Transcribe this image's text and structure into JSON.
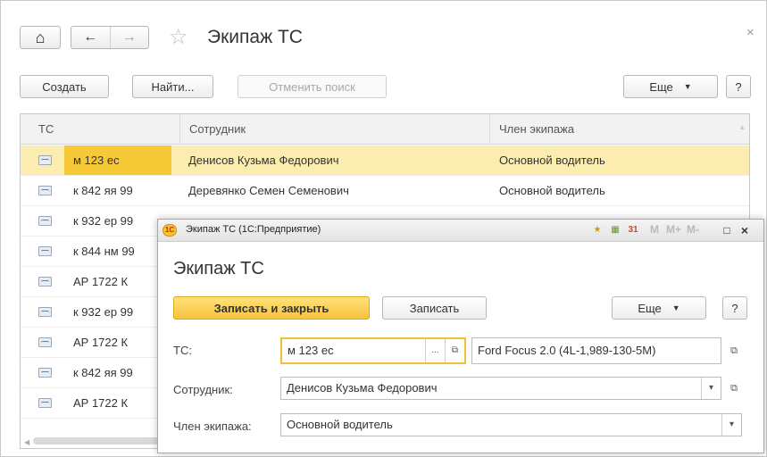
{
  "window": {
    "title": "Экипаж ТС",
    "close_glyph": "×",
    "home_glyph": "⌂",
    "back_glyph": "←",
    "forward_glyph": "→",
    "star_glyph": "☆"
  },
  "toolbar": {
    "create": "Создать",
    "find": "Найти...",
    "cancel_search": "Отменить поиск",
    "more": "Еще",
    "help": "?"
  },
  "table": {
    "columns": [
      "ТС",
      "Сотрудник",
      "Член экипажа"
    ],
    "rows": [
      {
        "ts": "м 123 ес",
        "employee": "Денисов Кузьма Федорович",
        "role": "Основной водитель"
      },
      {
        "ts": "к 842 яя 99",
        "employee": "Деревянко Семен Семенович",
        "role": "Основной водитель"
      },
      {
        "ts": "к 932 ер 99",
        "employee": "",
        "role": ""
      },
      {
        "ts": "к 844 нм 99",
        "employee": "",
        "role": ""
      },
      {
        "ts": "АР 1722 К",
        "employee": "",
        "role": ""
      },
      {
        "ts": "к 932 ер 99",
        "employee": "",
        "role": ""
      },
      {
        "ts": "АР 1722 К",
        "employee": "",
        "role": ""
      },
      {
        "ts": "к 842 яя 99",
        "employee": "",
        "role": ""
      },
      {
        "ts": "АР 1722 К",
        "employee": "",
        "role": ""
      }
    ]
  },
  "dialog": {
    "caption": "Экипаж ТС (1С:Предприятие)",
    "logo_text": "1С",
    "title": "Экипаж ТС",
    "m_buttons": [
      "M",
      "M+",
      "M-"
    ],
    "save_close": "Записать и закрыть",
    "save": "Записать",
    "more": "Еще",
    "help": "?",
    "fields": {
      "ts_label": "ТС:",
      "ts_value": "м 123 ес",
      "ts_desc": "Ford Focus 2.0 (4L-1,989-130-5M)",
      "employee_label": "Сотрудник:",
      "employee_value": "Денисов Кузьма Федорович",
      "role_label": "Член экипажа:",
      "role_value": "Основной водитель"
    }
  },
  "colors": {
    "selection": "#fbecb0",
    "selection_cell": "#f6c937",
    "primary_button": "#f7c33d"
  }
}
